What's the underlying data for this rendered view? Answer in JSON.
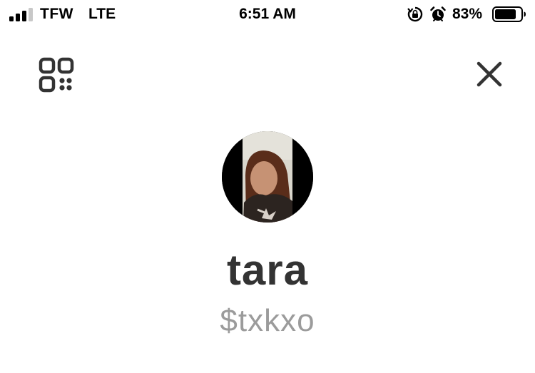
{
  "status_bar": {
    "carrier": "TFW",
    "network": "LTE",
    "time": "6:51 AM",
    "battery_percent": "83%",
    "signal_bars": 3,
    "battery_level": 0.83,
    "icons": [
      "signal-icon",
      "orientation-lock-icon",
      "alarm-icon",
      "battery-icon"
    ]
  },
  "header": {
    "left_icon": "qr-code-icon",
    "right_icon": "close-icon"
  },
  "profile": {
    "avatar_icon": "profile-photo",
    "display_name": "tara",
    "cashtag": "$txkxo"
  },
  "colors": {
    "name_text": "#333333",
    "cashtag_text": "#9b9b9b",
    "icon": "#333333"
  }
}
